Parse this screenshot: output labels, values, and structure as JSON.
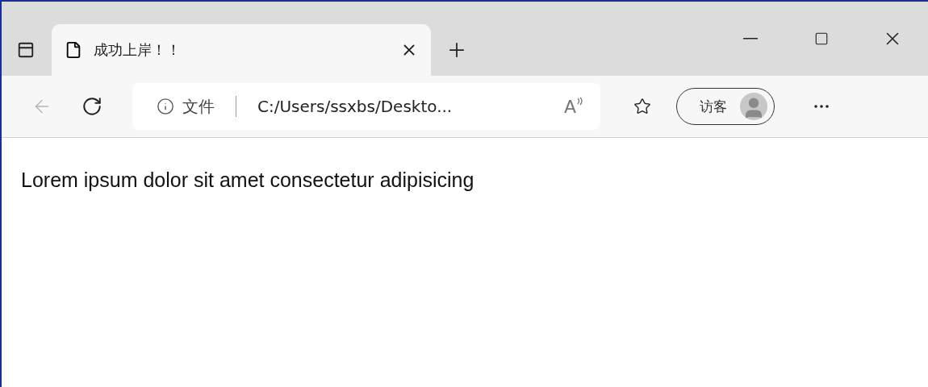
{
  "tabs": [
    {
      "title": "成功上岸！！",
      "selected": true
    }
  ],
  "toolbar": {
    "back": {
      "disabled": true
    },
    "site_info": "文件",
    "address": "C:/Users/ssxbs/Deskto...",
    "read_aloud_glyph": "A",
    "profile": "访客"
  },
  "page": {
    "text": "Lorem ipsum dolor sit amet consectetur adipisicing"
  }
}
